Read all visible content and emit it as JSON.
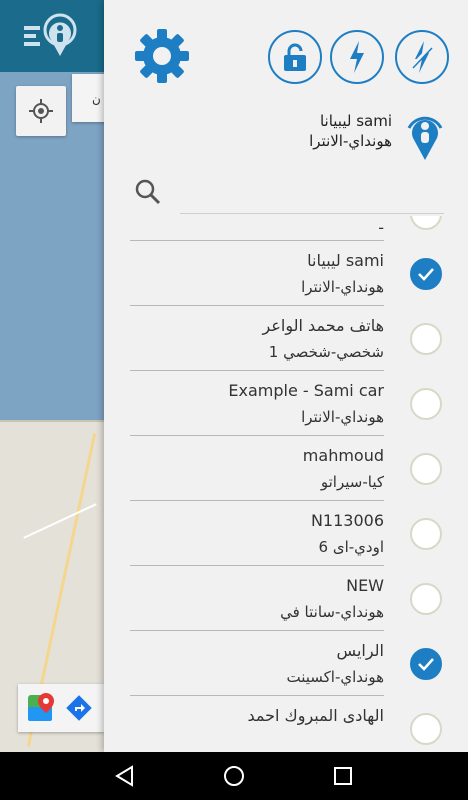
{
  "drawer": {
    "selected_car": {
      "name": "ليبيانا sami",
      "model": "هونداي-الانترا"
    },
    "search": {
      "placeholder": "",
      "value": ""
    },
    "accent_color": "#1e7ec3",
    "items": [
      {
        "name": "",
        "model": "-",
        "checked": false
      },
      {
        "name": "ليبيانا sami",
        "model": "هونداي-الانترا",
        "checked": true
      },
      {
        "name": "هاتف محمد الواعر",
        "model": "شخصي-شخصي 1",
        "checked": false
      },
      {
        "name": "Example - Sami car",
        "model": "هونداي-الانترا",
        "checked": false
      },
      {
        "name": "mahmoud",
        "model": "كيا-سيراتو",
        "checked": false
      },
      {
        "name": "N113006",
        "model": "اودي-اى 6",
        "checked": false
      },
      {
        "name": "NEW",
        "model": "هونداي-سانتا في",
        "checked": false
      },
      {
        "name": "الرايس",
        "model": "هونداي-اكسينت",
        "checked": true
      },
      {
        "name": "الهادى المبروك احمد",
        "model": "",
        "checked": false
      }
    ]
  },
  "icons": {
    "settings": "gear-icon",
    "lock": "lock-icon",
    "power_on": "lightning-icon",
    "power_off": "lightning-off-icon",
    "pin": "location-pin-icon",
    "search": "search-icon"
  },
  "map": {
    "chip_text": "ن"
  },
  "navbar": {
    "back": "back-icon",
    "home": "home-icon",
    "recents": "recents-icon"
  }
}
